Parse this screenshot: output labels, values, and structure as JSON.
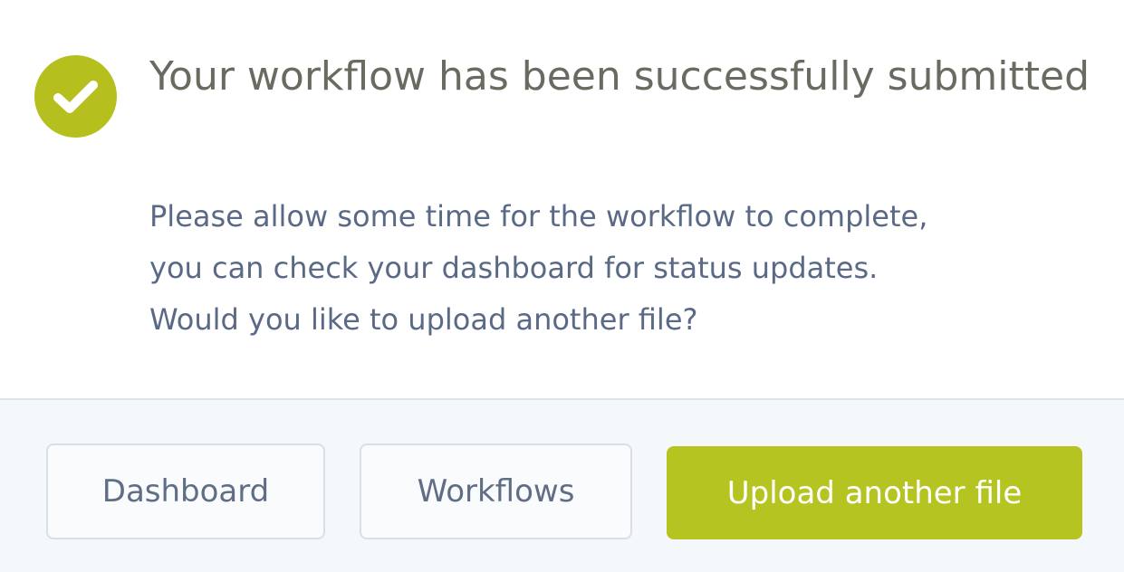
{
  "dialog": {
    "title": "Your workflow has been successfully submitted",
    "message_lines": [
      "Please allow some time for the workflow to complete,",
      "you can check your dashboard for status updates.",
      "Would you like to upload another file?"
    ],
    "icon": "check-circle-icon"
  },
  "footer": {
    "buttons": {
      "dashboard": "Dashboard",
      "workflows": "Workflows",
      "upload": "Upload another file"
    }
  },
  "colors": {
    "accent": "#b5c01f",
    "title_text": "#6b6a61",
    "body_text": "#5a6a86",
    "footer_bg": "#f5f8fb"
  }
}
